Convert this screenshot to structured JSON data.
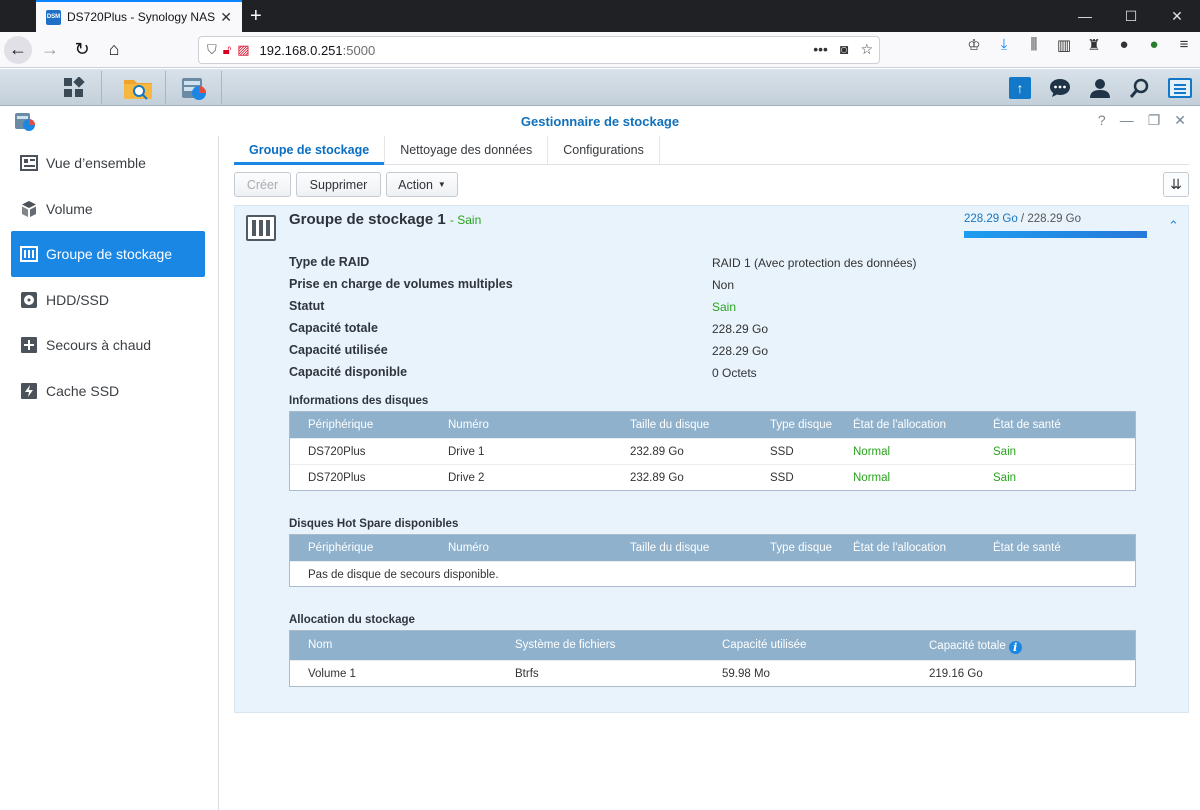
{
  "browser": {
    "tab_title": "DS720Plus - Synology NAS",
    "tab_favicon": "DSM",
    "url_host": "192.168.0.251",
    "url_port": ":5000"
  },
  "window": {
    "title": "Gestionnaire de stockage"
  },
  "sidebar": {
    "items": [
      {
        "label": "Vue d’ensemble",
        "icon": "overview-icon"
      },
      {
        "label": "Volume",
        "icon": "volume-icon"
      },
      {
        "label": "Groupe de stockage",
        "icon": "storage-pool-icon",
        "active": true
      },
      {
        "label": "HDD/SSD",
        "icon": "disk-icon"
      },
      {
        "label": "Secours à chaud",
        "icon": "hot-spare-icon"
      },
      {
        "label": "Cache SSD",
        "icon": "ssd-cache-icon"
      }
    ]
  },
  "tabs": [
    "Groupe de stockage",
    "Nettoyage des données",
    "Configurations"
  ],
  "toolbar": {
    "create": "Créer",
    "delete": "Supprimer",
    "action": "Action"
  },
  "pool": {
    "name": "Groupe de stockage 1",
    "status": "- Sain",
    "usage_used": "228.29 Go",
    "usage_sep": " / ",
    "usage_total": "228.29 Go",
    "usage_fraction": 1.0,
    "properties": [
      {
        "label": "Type de RAID",
        "value": "RAID 1 (Avec protection des données)"
      },
      {
        "label": "Prise en charge de volumes multiples",
        "value": "Non"
      },
      {
        "label": "Statut",
        "value": "Sain"
      },
      {
        "label": "Capacité totale",
        "value": "228.29 Go"
      },
      {
        "label": "Capacité utilisée",
        "value": "228.29 Go"
      },
      {
        "label": "Capacité disponible",
        "value": "0 Octets"
      }
    ]
  },
  "disks": {
    "title": "Informations des disques",
    "columns": [
      "Périphérique",
      "Numéro",
      "Taille du disque",
      "Type disque",
      "État de l'allocation",
      "État de santé"
    ],
    "rows": [
      [
        "DS720Plus",
        "Drive 1",
        "232.89 Go",
        "SSD",
        "Normal",
        "Sain"
      ],
      [
        "DS720Plus",
        "Drive 2",
        "232.89 Go",
        "SSD",
        "Normal",
        "Sain"
      ]
    ]
  },
  "hotspare": {
    "title": "Disques Hot Spare disponibles",
    "columns": [
      "Périphérique",
      "Numéro",
      "Taille du disque",
      "Type disque",
      "État de l'allocation",
      "État de santé"
    ],
    "empty": "Pas de disque de secours disponible."
  },
  "allocation": {
    "title": "Allocation du stockage",
    "columns": [
      "Nom",
      "Système de fichiers",
      "Capacité utilisée",
      "Capacité totale"
    ],
    "rows": [
      [
        "Volume 1",
        "Btrfs",
        "59.98 Mo",
        "219.16 Go"
      ]
    ]
  },
  "colors": {
    "accent": "#1b87e5",
    "ok": "#2aa31e",
    "title": "#1070bb"
  }
}
